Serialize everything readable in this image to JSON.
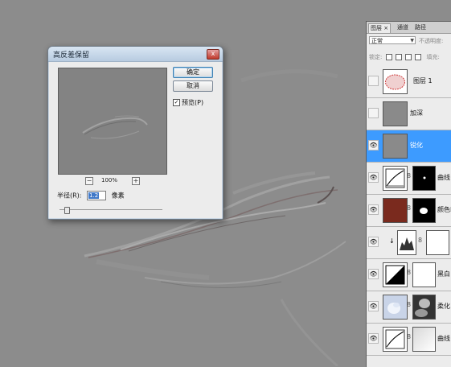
{
  "dialog": {
    "title": "高反差保留",
    "close_label": "x",
    "ok_label": "确定",
    "cancel_label": "取消",
    "preview_label": "预览(P)",
    "preview_checked": true,
    "zoom_level": "100%",
    "zoom_out": "−",
    "zoom_in": "+",
    "radius_label": "半径(R):",
    "radius_value": "1.2",
    "radius_unit": "像素",
    "slider_level": 0.05
  },
  "panel": {
    "tabs": [
      "图层",
      "通道",
      "路径"
    ],
    "tab_close": "×",
    "blend_mode": "正常",
    "opacity_label": "不透明度:",
    "lock_label": "锁定:",
    "fill_label": "填充:",
    "layers": [
      {
        "name": "图层 1",
        "visible": false,
        "selected": false,
        "thumb": "red-oval"
      },
      {
        "name": "加深",
        "visible": false,
        "selected": false,
        "thumb": "gray"
      },
      {
        "name": "锐化",
        "visible": true,
        "selected": true,
        "thumb": "gray"
      },
      {
        "name": "曲线",
        "visible": true,
        "selected": false,
        "thumb": "curves",
        "mask": "black-dot"
      },
      {
        "name": "颜色I",
        "visible": true,
        "selected": false,
        "thumb": "brown",
        "mask": "black-blob"
      },
      {
        "name": "",
        "visible": true,
        "selected": false,
        "thumb": "levels",
        "mask": "white",
        "clipped": true
      },
      {
        "name": "黑白",
        "visible": true,
        "selected": false,
        "thumb": "bw",
        "mask": "white"
      },
      {
        "name": "柔化",
        "visible": true,
        "selected": false,
        "thumb": "photo",
        "mask": "soft"
      },
      {
        "name": "曲线",
        "visible": true,
        "selected": false,
        "thumb": "curves",
        "mask": "gradient"
      }
    ]
  },
  "colors": {
    "canvas": "#8c8c8c",
    "selection": "#3d9bff",
    "brown_fill": "#7a2a1e"
  }
}
